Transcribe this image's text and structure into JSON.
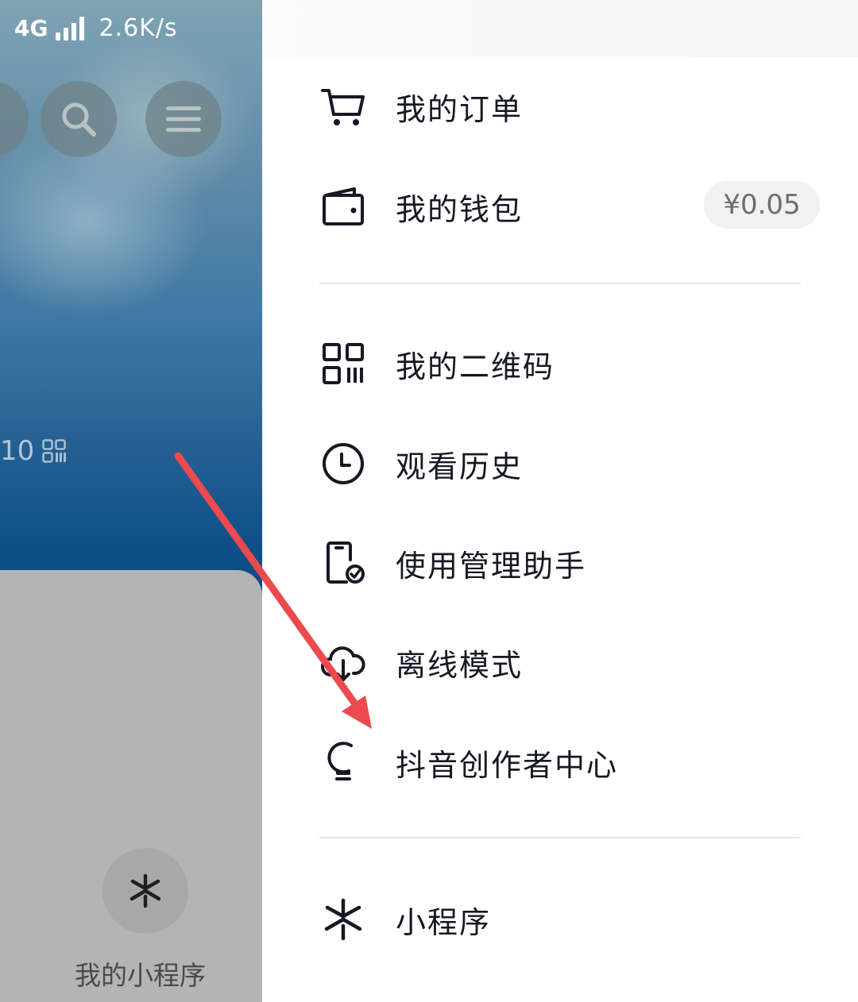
{
  "status_bar": {
    "network": "4G",
    "speed": "2.6K/s"
  },
  "background": {
    "qr_fragment": "10",
    "mini_programs_label": "我的小程序"
  },
  "drawer": {
    "items": [
      {
        "label": "我的订单",
        "icon": "cart-icon"
      },
      {
        "label": "我的钱包",
        "icon": "wallet-icon",
        "badge": "¥0.05"
      },
      {
        "label": "我的二维码",
        "icon": "qr-code-icon"
      },
      {
        "label": "观看历史",
        "icon": "clock-icon"
      },
      {
        "label": "使用管理助手",
        "icon": "phone-check-icon"
      },
      {
        "label": "离线模式",
        "icon": "cloud-download-icon"
      },
      {
        "label": "抖音创作者中心",
        "icon": "lightbulb-icon"
      },
      {
        "label": "小程序",
        "icon": "mini-program-icon"
      }
    ]
  },
  "annotation": {
    "arrow_color": "#ec4a4f"
  }
}
